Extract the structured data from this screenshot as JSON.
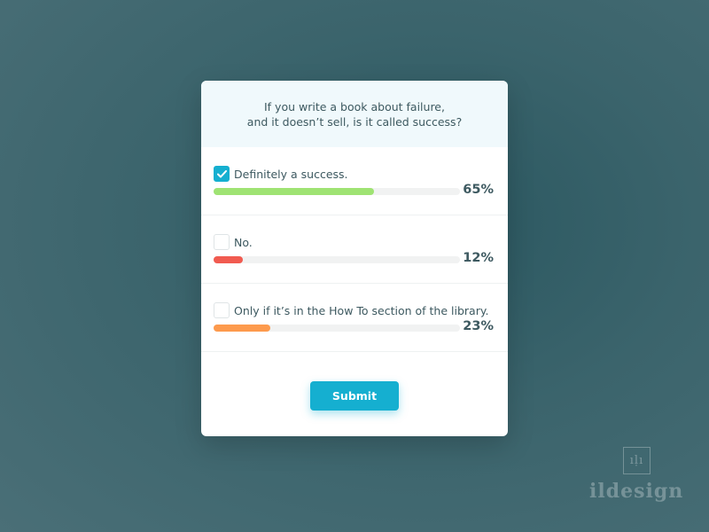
{
  "poll": {
    "question_line1": "If you write a book about failure,",
    "question_line2": "and it doesn’t sell, is it called success?",
    "options": [
      {
        "label": "Definitely a success.",
        "checked": true,
        "percent_text": "65%",
        "percent": 65,
        "color": "#9fe373"
      },
      {
        "label": "No.",
        "checked": false,
        "percent_text": "12%",
        "percent": 12,
        "color": "#f15b50"
      },
      {
        "label": "Only if it’s in the How To section of the library.",
        "checked": false,
        "percent_text": "23%",
        "percent": 23,
        "color": "#fd9a4d"
      }
    ],
    "submit_label": "Submit"
  },
  "colors": {
    "accent": "#15afd0",
    "text": "#3d5960",
    "question_bg": "#f0f9fc"
  },
  "icons": {
    "checkmark": "check-icon"
  },
  "watermark": {
    "logo_text": "ıḷı",
    "brand_text": "ildesign"
  }
}
